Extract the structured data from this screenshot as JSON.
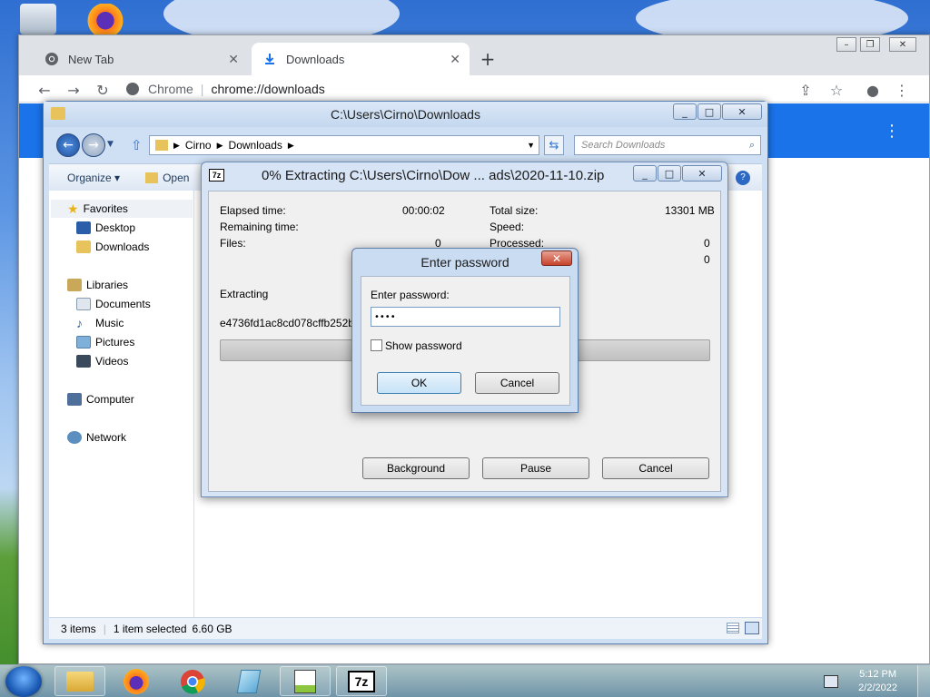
{
  "chrome": {
    "tabs": [
      {
        "label": "New Tab",
        "icon": "chrome-icon"
      },
      {
        "label": "Downloads",
        "icon": "download-icon"
      }
    ],
    "omnibox": {
      "scheme_label": "Chrome",
      "url": "chrome://downloads"
    }
  },
  "explorer": {
    "title": "C:\\Users\\Cirno\\Downloads",
    "breadcrumb": [
      "Cirno",
      "Downloads"
    ],
    "search_placeholder": "Search Downloads",
    "commands": {
      "organize": "Organize",
      "open": "Open"
    },
    "nav": {
      "favorites": "Favorites",
      "desktop": "Desktop",
      "downloads": "Downloads",
      "libraries": "Libraries",
      "documents": "Documents",
      "music": "Music",
      "pictures": "Pictures",
      "videos": "Videos",
      "computer": "Computer",
      "network": "Network"
    },
    "status": {
      "items": "3 items",
      "selected": "1 item selected",
      "size": "6.60 GB"
    }
  },
  "zip": {
    "icon_text": "7z",
    "title": "0% Extracting C:\\Users\\Cirno\\Dow ... ads\\2020-11-10.zip",
    "elapsed_label": "Elapsed time:",
    "elapsed_value": "00:00:02",
    "remaining_label": "Remaining time:",
    "files_label": "Files:",
    "files_value": "0",
    "total_size_label": "Total size:",
    "total_size_value": "13301 MB",
    "speed_label": "Speed:",
    "processed_label": "Processed:",
    "processed_value": "0",
    "extra_value": "0",
    "extracting_label": "Extracting",
    "current_file": "e4736fd1ac8cd078cffb252bea",
    "progress": 0,
    "buttons": {
      "background": "Background",
      "pause": "Pause",
      "cancel": "Cancel"
    }
  },
  "password_dialog": {
    "title": "Enter password",
    "prompt": "Enter password:",
    "value": "••••",
    "show_password_label": "Show password",
    "show_password_checked": false,
    "ok": "OK",
    "cancel": "Cancel"
  },
  "taskbar": {
    "time": "5:12 PM",
    "date": "2/2/2022",
    "apps": [
      "explorer-icon",
      "firefox-icon",
      "chrome-icon",
      "notepad-icon",
      "notepadpp-icon",
      "7zip-icon"
    ],
    "zip_label": "7z"
  }
}
